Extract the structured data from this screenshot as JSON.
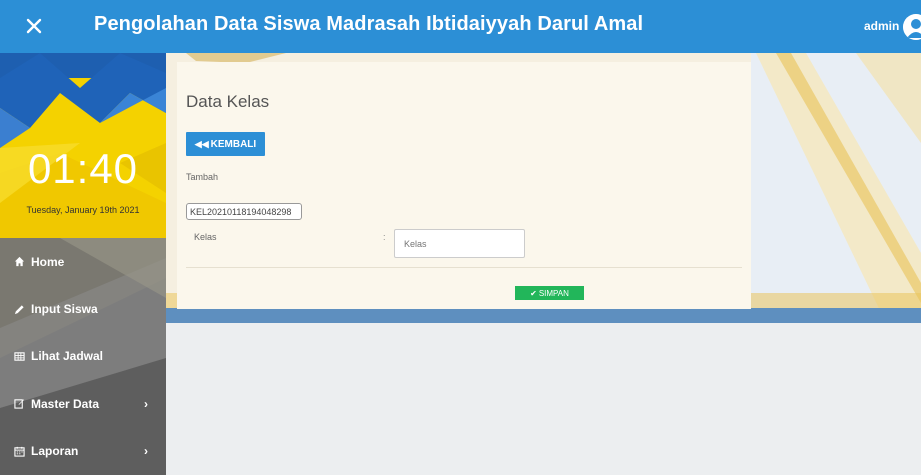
{
  "header": {
    "title": "Pengolahan Data Siswa Madrasah Ibtidaiyyah Darul Amal",
    "user_name": "admin",
    "close_icon": "close-icon",
    "avatar_icon": "user-avatar"
  },
  "sidebar": {
    "clock": "01:40",
    "date": "Tuesday, January 19th 2021",
    "items": [
      {
        "label": "Home",
        "icon": "home-icon",
        "has_submenu": false
      },
      {
        "label": "Input Siswa",
        "icon": "pencil-icon",
        "has_submenu": false
      },
      {
        "label": "Lihat Jadwal",
        "icon": "table-icon",
        "has_submenu": false
      },
      {
        "label": "Master Data",
        "icon": "edit-icon",
        "has_submenu": true,
        "chevron": "›"
      },
      {
        "label": "Laporan",
        "icon": "calendar-icon",
        "has_submenu": true,
        "chevron": "›"
      }
    ]
  },
  "main": {
    "page_title": "Data Kelas",
    "back_button": "KEMBALI",
    "section_label": "Tambah",
    "id_value": "KEL20210118194048298",
    "kelas_label": "Kelas",
    "colon": ":",
    "kelas_placeholder": "Kelas",
    "save_button": "SIMPAN"
  },
  "colors": {
    "header_bg": "#2c8fd6",
    "sidebar_bg": "#6a6a6a",
    "accent_yellow": "#f6d600",
    "save_green": "#22b65a"
  }
}
